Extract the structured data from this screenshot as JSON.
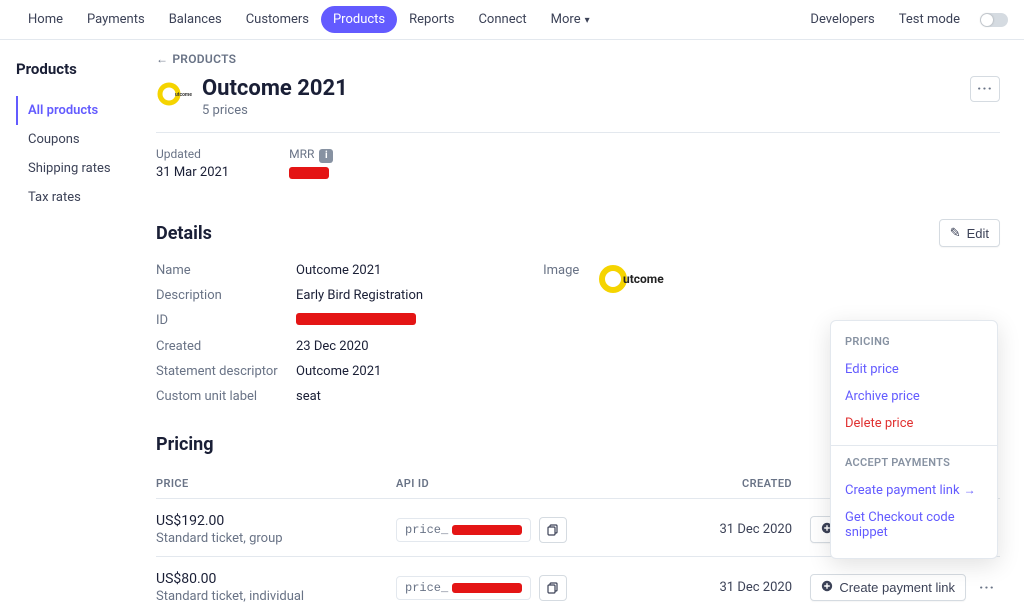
{
  "topnav": {
    "items": [
      "Home",
      "Payments",
      "Balances",
      "Customers",
      "Products",
      "Reports",
      "Connect",
      "More"
    ],
    "active": "Products",
    "right": {
      "developers": "Developers",
      "test_mode": "Test mode"
    }
  },
  "sidebar": {
    "title": "Products",
    "items": [
      "All products",
      "Coupons",
      "Shipping rates",
      "Tax rates"
    ],
    "active": "All products"
  },
  "back_link": "PRODUCTS",
  "product": {
    "name": "Outcome 2021",
    "subtitle": "5 prices",
    "updated_label": "Updated",
    "updated_value": "31 Mar 2021",
    "mrr_label": "MRR"
  },
  "details": {
    "heading": "Details",
    "edit_label": "Edit",
    "rows": {
      "name_k": "Name",
      "name_v": "Outcome 2021",
      "desc_k": "Description",
      "desc_v": "Early Bird Registration",
      "id_k": "ID",
      "created_k": "Created",
      "created_v": "23 Dec 2020",
      "stmt_k": "Statement descriptor",
      "stmt_v": "Outcome 2021",
      "unit_k": "Custom unit label",
      "unit_v": "seat",
      "image_k": "Image"
    }
  },
  "pricing": {
    "heading": "Pricing",
    "columns": {
      "price": "PRICE",
      "api": "API ID",
      "created": "CREATED"
    },
    "create_label": "Create payment link",
    "api_prefix": "price_",
    "rows": [
      {
        "amount": "US$192.00",
        "desc": "Standard ticket, group",
        "created": "31 Dec 2020"
      },
      {
        "amount": "US$80.00",
        "desc": "Standard ticket, individual",
        "created": "31 Dec 2020"
      }
    ]
  },
  "popover": {
    "group1_label": "PRICING",
    "edit_price": "Edit price",
    "archive_price": "Archive price",
    "delete_price": "Delete price",
    "group2_label": "ACCEPT PAYMENTS",
    "create_link": "Create payment link",
    "checkout_snippet": "Get Checkout code snippet"
  }
}
